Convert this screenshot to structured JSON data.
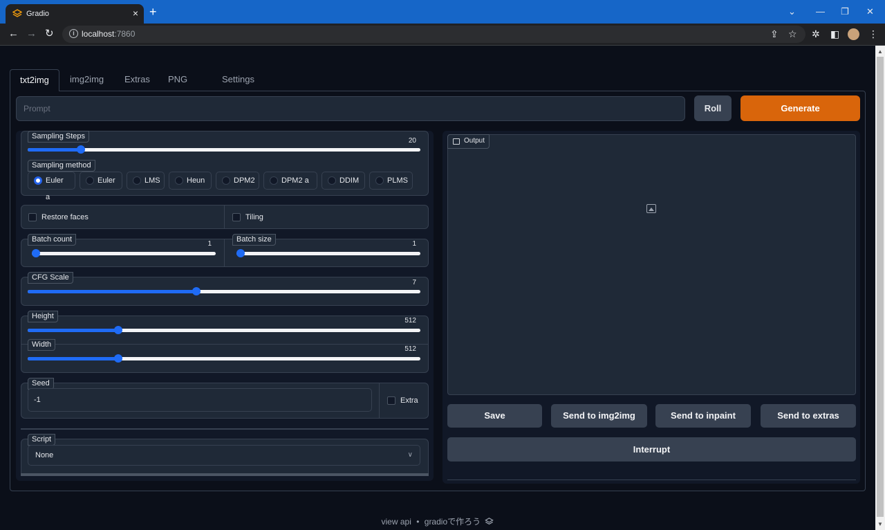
{
  "browser": {
    "tab_title": "Gradio",
    "new_tab": "+",
    "url_host": "localhost",
    "url_port": ":7860"
  },
  "tabs": [
    "txt2img",
    "img2img",
    "Extras",
    "PNG Info",
    "Settings"
  ],
  "prompt": {
    "placeholder": "Prompt",
    "value": ""
  },
  "buttons": {
    "roll": "Roll",
    "generate": "Generate"
  },
  "sampling_steps": {
    "label": "Sampling Steps",
    "value": "20",
    "fraction": 0.135
  },
  "sampling_method": {
    "label": "Sampling method",
    "options": [
      "Euler a",
      "Euler",
      "LMS",
      "Heun",
      "DPM2",
      "DPM2 a",
      "DDIM",
      "PLMS"
    ],
    "selected": "Euler a"
  },
  "restore_faces": {
    "label": "Restore faces",
    "checked": false
  },
  "tiling": {
    "label": "Tiling",
    "checked": false
  },
  "batch_count": {
    "label": "Batch count",
    "value": "1",
    "fraction": 0.0
  },
  "batch_size": {
    "label": "Batch size",
    "value": "1",
    "fraction": 0.0
  },
  "cfg_scale": {
    "label": "CFG Scale",
    "value": "7",
    "fraction": 0.43
  },
  "height": {
    "label": "Height",
    "value": "512",
    "fraction": 0.23
  },
  "width": {
    "label": "Width",
    "value": "512",
    "fraction": 0.23
  },
  "seed": {
    "label": "Seed",
    "value": "-1",
    "extra_label": "Extra"
  },
  "script": {
    "label": "Script",
    "value": "None"
  },
  "output": {
    "label": "Output"
  },
  "actions": {
    "save": "Save",
    "send_img2img": "Send to img2img",
    "send_inpaint": "Send to inpaint",
    "send_extras": "Send to extras",
    "interrupt": "Interrupt"
  },
  "footer": {
    "view_api": "view api",
    "separator": "•",
    "built_with": "gradioで作ろう"
  },
  "colors": {
    "accent": "#1f6bf5",
    "generate": "#d9650b",
    "background": "#0b0f19",
    "panel": "#1f2937"
  }
}
